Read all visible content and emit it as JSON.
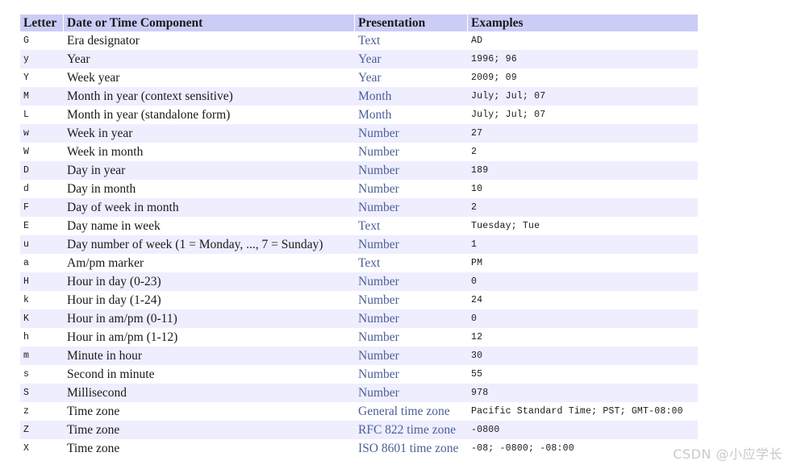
{
  "table": {
    "columns": [
      {
        "key": "letter",
        "label": "Letter"
      },
      {
        "key": "component",
        "label": "Date or Time Component"
      },
      {
        "key": "presentation",
        "label": "Presentation"
      },
      {
        "key": "examples",
        "label": "Examples"
      }
    ],
    "rows": [
      {
        "letter": "G",
        "component": "Era designator",
        "presentation": "Text",
        "examples": "AD"
      },
      {
        "letter": "y",
        "component": "Year",
        "presentation": "Year",
        "examples": "1996; 96"
      },
      {
        "letter": "Y",
        "component": "Week year",
        "presentation": "Year",
        "examples": "2009; 09"
      },
      {
        "letter": "M",
        "component": "Month in year (context sensitive)",
        "presentation": "Month",
        "examples": "July; Jul; 07"
      },
      {
        "letter": "L",
        "component": "Month in year (standalone form)",
        "presentation": "Month",
        "examples": "July; Jul; 07"
      },
      {
        "letter": "w",
        "component": "Week in year",
        "presentation": "Number",
        "examples": "27"
      },
      {
        "letter": "W",
        "component": "Week in month",
        "presentation": "Number",
        "examples": "2"
      },
      {
        "letter": "D",
        "component": "Day in year",
        "presentation": "Number",
        "examples": "189"
      },
      {
        "letter": "d",
        "component": "Day in month",
        "presentation": "Number",
        "examples": "10"
      },
      {
        "letter": "F",
        "component": "Day of week in month",
        "presentation": "Number",
        "examples": "2"
      },
      {
        "letter": "E",
        "component": "Day name in week",
        "presentation": "Text",
        "examples": "Tuesday; Tue"
      },
      {
        "letter": "u",
        "component": "Day number of week (1 = Monday, ..., 7 = Sunday)",
        "presentation": "Number",
        "examples": "1"
      },
      {
        "letter": "a",
        "component": "Am/pm marker",
        "presentation": "Text",
        "examples": "PM"
      },
      {
        "letter": "H",
        "component": "Hour in day (0-23)",
        "presentation": "Number",
        "examples": "0"
      },
      {
        "letter": "k",
        "component": "Hour in day (1-24)",
        "presentation": "Number",
        "examples": "24"
      },
      {
        "letter": "K",
        "component": "Hour in am/pm (0-11)",
        "presentation": "Number",
        "examples": "0"
      },
      {
        "letter": "h",
        "component": "Hour in am/pm (1-12)",
        "presentation": "Number",
        "examples": "12"
      },
      {
        "letter": "m",
        "component": "Minute in hour",
        "presentation": "Number",
        "examples": "30"
      },
      {
        "letter": "s",
        "component": "Second in minute",
        "presentation": "Number",
        "examples": "55"
      },
      {
        "letter": "S",
        "component": "Millisecond",
        "presentation": "Number",
        "examples": "978"
      },
      {
        "letter": "z",
        "component": "Time zone",
        "presentation": "General time zone",
        "examples": "Pacific Standard Time; PST; GMT-08:00"
      },
      {
        "letter": "Z",
        "component": "Time zone",
        "presentation": "RFC 822 time zone",
        "examples": "-0800"
      },
      {
        "letter": "X",
        "component": "Time zone",
        "presentation": "ISO 8601 time zone",
        "examples": "-08; -0800; -08:00"
      }
    ]
  },
  "watermark": {
    "text": "CSDN @小应学长"
  },
  "colors": {
    "header_background": "#cccdf7",
    "stripe_background": "#eeeeff",
    "presentation_text": "#4c5f96",
    "body_text": "#1a1a1a",
    "watermark_text": "#c9c9c9"
  }
}
